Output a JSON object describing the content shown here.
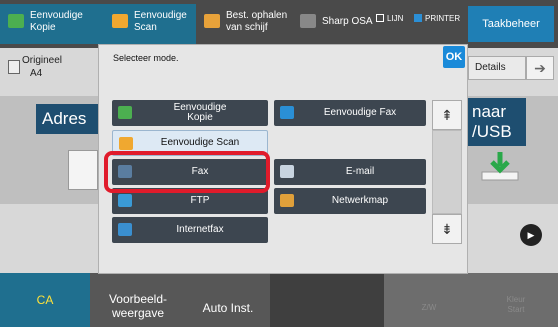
{
  "tabs": [
    {
      "label": "Eenvoudige\nKopie",
      "icon": "copy-icon",
      "color": "#4caf50"
    },
    {
      "label": "Eenvoudige\nScan",
      "icon": "scan-icon",
      "color": "#f0a830"
    },
    {
      "label": "Best. ophalen\nvan schijf",
      "icon": "folder-icon",
      "color": "#e8a23a"
    },
    {
      "label": "Sharp OSA",
      "icon": "osa-icon",
      "color": "#888888"
    }
  ],
  "status": {
    "line": "LIJN",
    "printer": "PRINTER"
  },
  "taakbeheer": "Taakbeheer",
  "background": {
    "original_label": "Origineel",
    "original_value": "A4",
    "details": "Details",
    "address": "Adres",
    "naar": "naar",
    "usb": "/USB"
  },
  "dialog": {
    "title": "Selecteer mode.",
    "ok": "OK",
    "modes": [
      {
        "label": "Eenvoudige\nKopie",
        "icon": "copy-icon"
      },
      {
        "label": "Eenvoudige Fax",
        "icon": "fax-icon"
      },
      {
        "label": "Eenvoudige Scan",
        "icon": "scan-icon",
        "selected": true
      },
      {
        "label": "Fax",
        "icon": "fax-icon",
        "highlighted": true
      },
      {
        "label": "E-mail",
        "icon": "mail-icon"
      },
      {
        "label": "FTP",
        "icon": "ftp-icon"
      },
      {
        "label": "Netwerkmap",
        "icon": "network-folder-icon"
      },
      {
        "label": "Internetfax",
        "icon": "internet-fax-icon"
      }
    ]
  },
  "bottom": {
    "ca": "CA",
    "preview": "Voorbeeld-\nweergave",
    "auto": "Auto Inst.",
    "bw_start": "Z/W",
    "color_start": "Kleur\nStart"
  }
}
